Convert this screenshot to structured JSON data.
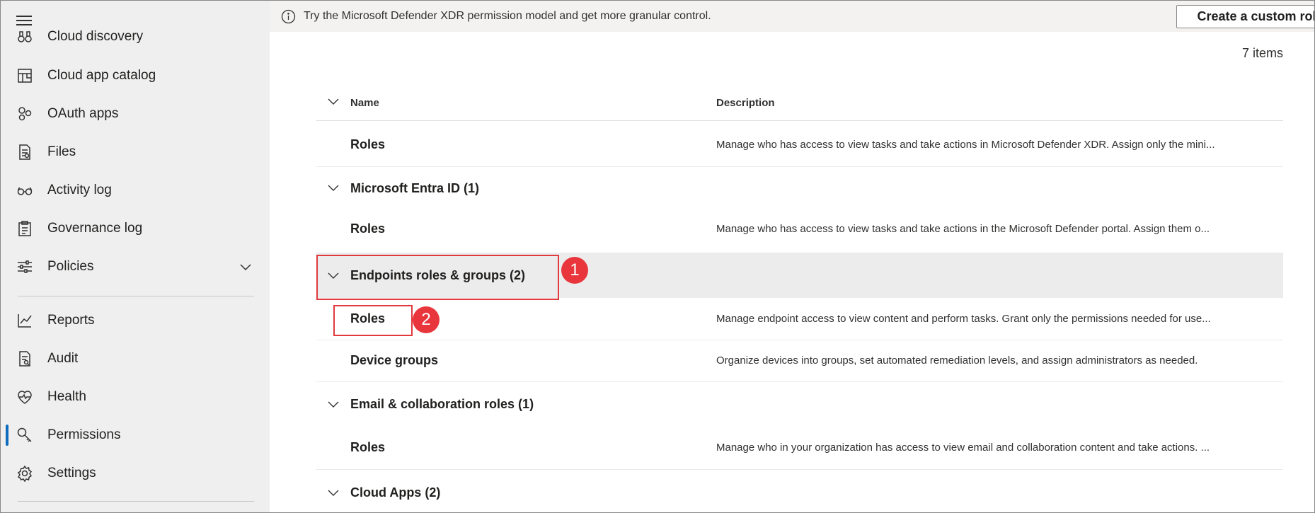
{
  "sidebar": {
    "items": [
      {
        "label": "Cloud discovery",
        "icon": "binoculars-icon"
      },
      {
        "label": "Cloud app catalog",
        "icon": "app-catalog-icon"
      },
      {
        "label": "OAuth apps",
        "icon": "oauth-apps-icon"
      },
      {
        "label": "Files",
        "icon": "file-icon"
      },
      {
        "label": "Activity log",
        "icon": "glasses-icon"
      },
      {
        "label": "Governance log",
        "icon": "clipboard-icon"
      },
      {
        "label": "Policies",
        "icon": "sliders-icon"
      },
      {
        "label": "Reports",
        "icon": "line-chart-icon"
      },
      {
        "label": "Audit",
        "icon": "audit-icon"
      },
      {
        "label": "Health",
        "icon": "heart-icon"
      },
      {
        "label": "Permissions",
        "icon": "key-icon"
      },
      {
        "label": "Settings",
        "icon": "gear-icon"
      }
    ],
    "selected": "Permissions",
    "accent": "#0f6cbd"
  },
  "banner": {
    "message": "Try the Microsoft Defender XDR permission model and get more granular control.",
    "button_label": "Create a custom role"
  },
  "main": {
    "items_count": "7 items",
    "columns": {
      "name": "Name",
      "description": "Description"
    },
    "rows": [
      {
        "name": "Roles",
        "description": "Manage who has access to view tasks and take actions in Microsoft Defender XDR. Assign only the mini..."
      }
    ],
    "groups": [
      {
        "name": "Microsoft Entra ID (1)",
        "rows": [
          {
            "name": "Roles",
            "description": "Manage who has access to view tasks and take actions in the Microsoft Defender portal. Assign them o..."
          }
        ]
      },
      {
        "name": "Endpoints roles & groups (2)",
        "rows": [
          {
            "name": "Roles",
            "description": "Manage endpoint access to view content and perform tasks. Grant only the permissions needed for use..."
          },
          {
            "name": "Device groups",
            "description": "Organize devices into groups, set automated remediation levels, and assign administrators as needed."
          }
        ]
      },
      {
        "name": "Email & collaboration roles (1)",
        "rows": [
          {
            "name": "Roles",
            "description": "Manage who in your organization has access to view email and collaboration content and take actions. ..."
          }
        ]
      },
      {
        "name": "Cloud Apps (2)",
        "rows": []
      }
    ]
  },
  "annotations": {
    "badge1": "1",
    "badge2": "2",
    "color": "#e8363c"
  }
}
